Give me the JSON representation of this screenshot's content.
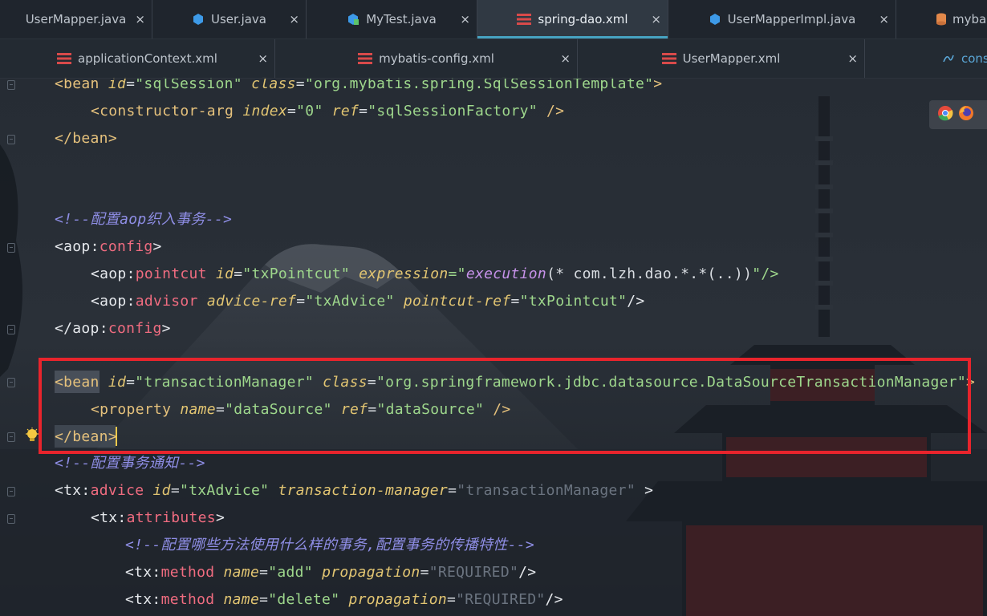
{
  "tabs_row1": [
    {
      "label": "UserMapper.java",
      "icon": "java-class-icon",
      "close": "×",
      "active": false
    },
    {
      "label": "User.java",
      "icon": "java-class-icon",
      "close": "×",
      "active": false
    },
    {
      "label": "MyTest.java",
      "icon": "java-test-icon",
      "close": "×",
      "active": false
    },
    {
      "label": "spring-dao.xml",
      "icon": "spring-xml-icon",
      "close": "×",
      "active": true
    },
    {
      "label": "UserMapperImpl.java",
      "icon": "java-class-icon",
      "close": "×",
      "active": false
    },
    {
      "label": "myba",
      "icon": "database-icon",
      "close": "",
      "active": false
    }
  ],
  "tabs_row2": [
    {
      "label": "applicationContext.xml",
      "icon": "spring-xml-icon",
      "close": "×"
    },
    {
      "label": "mybatis-config.xml",
      "icon": "spring-xml-icon",
      "close": "×"
    },
    {
      "label": "UserMapper.xml",
      "icon": "spring-xml-icon",
      "close": "×"
    },
    {
      "label": "cons",
      "icon": "console-icon",
      "close": ""
    }
  ],
  "code": {
    "l1": {
      "lt": "<",
      "tag": "bean",
      "a1": "id",
      "v1": "\"sqlSession\"",
      "a2": "class",
      "v2": "\"org.mybatis.spring.SqlSessionTemplate\"",
      "gt": ">"
    },
    "l2": {
      "lt": "<",
      "tag": "constructor-arg",
      "a1": "index",
      "v1": "\"0\"",
      "a2": "ref",
      "v2": "\"sqlSessionFactory\"",
      "end": " />"
    },
    "l3": {
      "text": "</bean>"
    },
    "l4": {
      "comment": "<!--配置aop织入事务-->"
    },
    "l5": {
      "lt": "<",
      "ns": "aop",
      "colon": ":",
      "tag": "config",
      "gt": ">"
    },
    "l6": {
      "lt": "<",
      "ns": "aop",
      "colon": ":",
      "tag": "pointcut",
      "a1": "id",
      "v1": "\"txPointcut\"",
      "a2": "expression",
      "eq": "=\"",
      "fn": "execution",
      "expr": "(* com.lzh.dao.*.*(..))",
      "end": "\"/>"
    },
    "l7": {
      "lt": "<",
      "ns": "aop",
      "colon": ":",
      "tag": "advisor",
      "a1": "advice-ref",
      "v1": "\"txAdvice\"",
      "a2": "pointcut-ref",
      "v2": "\"txPointcut\"",
      "end": "/>"
    },
    "l8": {
      "lt": "</",
      "ns": "aop",
      "colon": ":",
      "tag": "config",
      "gt": ">"
    },
    "l9": {
      "lt": "<",
      "tag": "bean",
      "a1": "id",
      "v1": "\"transactionManager\"",
      "a2": "class",
      "v2": "\"org.springframework.jdbc.datasource.DataSourceTransactionManager\"",
      "gt": ">"
    },
    "l10": {
      "lt": "<",
      "tag": "property",
      "a1": "name",
      "v1": "\"dataSource\"",
      "a2": "ref",
      "v2": "\"dataSource\"",
      "end": " />"
    },
    "l11": {
      "text": "</bean>"
    },
    "l12": {
      "comment": "<!--配置事务通知-->"
    },
    "l13": {
      "lt": "<",
      "ns": "tx",
      "colon": ":",
      "tag": "advice",
      "a1": "id",
      "v1": "\"txAdvice\"",
      "a2": "transaction-manager",
      "v2": "\"transactionManager\"",
      "gt": " >"
    },
    "l14": {
      "lt": "<",
      "ns": "tx",
      "colon": ":",
      "tag": "attributes",
      "gt": ">"
    },
    "l15": {
      "comment": "<!--配置哪些方法使用什么样的事务,配置事务的传播特性-->"
    },
    "l16": {
      "lt": "<",
      "ns": "tx",
      "colon": ":",
      "tag": "method",
      "a1": "name",
      "v1": "\"add\"",
      "a2": "propagation",
      "v2": "\"REQUIRED\"",
      "end": "/>"
    },
    "l17": {
      "lt": "<",
      "ns": "tx",
      "colon": ":",
      "tag": "method",
      "a1": "name",
      "v1": "\"delete\"",
      "a2": "propagation",
      "v2": "\"REQUIRED\"",
      "end": "/>"
    }
  },
  "colors": {
    "highlight_box": "#e8242c",
    "active_tab_underline": "#46a3c2",
    "caret": "#f2c94c"
  }
}
